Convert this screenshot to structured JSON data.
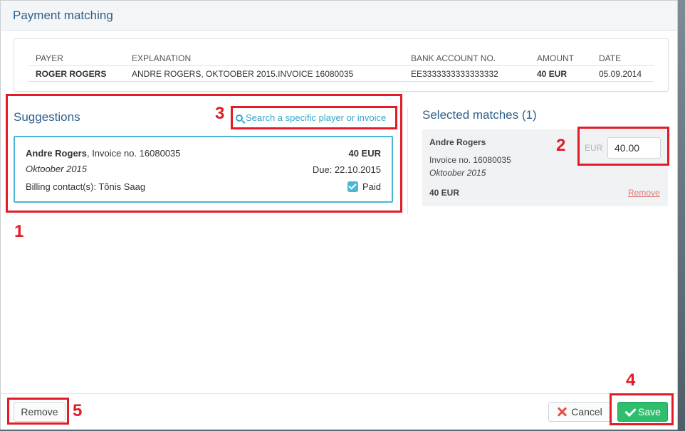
{
  "modal": {
    "title": "Payment matching"
  },
  "payment": {
    "headers": {
      "payer": "PAYER",
      "explanation": "EXPLANATION",
      "bank_account": "BANK ACCOUNT NO.",
      "amount": "AMOUNT",
      "date": "DATE"
    },
    "row": {
      "payer": "ROGER ROGERS",
      "explanation": "ANDRE ROGERS, OKTOOBER 2015.INVOICE 16080035",
      "bank_account": "EE3333333333333332",
      "amount": "40 EUR",
      "date": "05.09.2014"
    }
  },
  "suggestions": {
    "title": "Suggestions",
    "search_link": "Search a specific player or invoice",
    "items": [
      {
        "name": "Andre Rogers",
        "invoice": ", Invoice no. 16080035",
        "amount": "40 EUR",
        "period": "Oktoober 2015",
        "due": "Due: 22.10.2015",
        "billing": "Billing contact(s): Tõnis Saag",
        "status": "Paid"
      }
    ]
  },
  "selected": {
    "title": "Selected matches (1)",
    "items": [
      {
        "name": "Andre Rogers",
        "invoice": "Invoice no. 16080035",
        "period": "Oktoober 2015",
        "amount": "40 EUR",
        "currency": "EUR",
        "input_value": "40.00",
        "remove_label": "Remove"
      }
    ]
  },
  "footer": {
    "remove_label": "Remove",
    "cancel_label": "Cancel",
    "save_label": "Save"
  },
  "annotations": [
    "1",
    "2",
    "3",
    "4",
    "5"
  ],
  "colors": {
    "title": "#2d5f8a",
    "accent": "#4ab6d6",
    "save": "#2fbf6c",
    "annotation": "#e21b26",
    "remove_link": "#e0787a"
  }
}
